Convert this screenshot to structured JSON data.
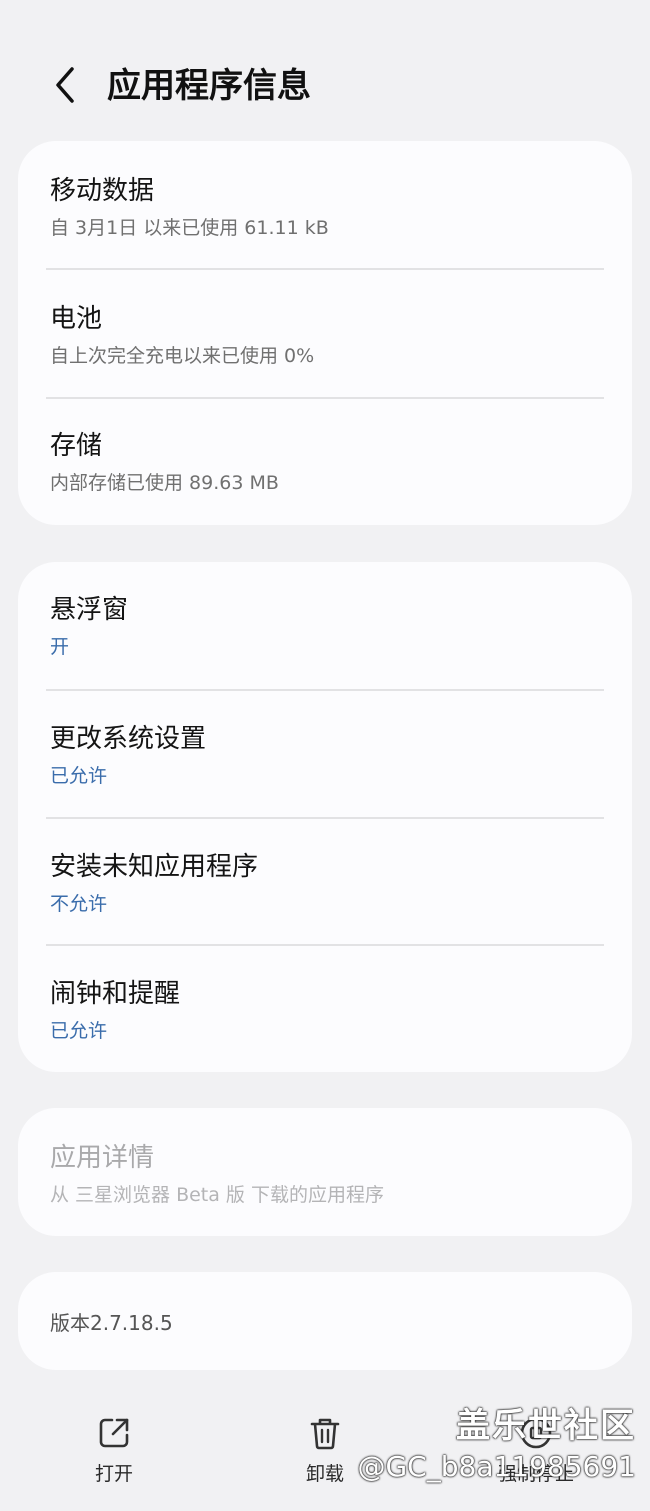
{
  "header": {
    "title": "应用程序信息"
  },
  "usage": {
    "items": [
      {
        "title": "移动数据",
        "subtitle": "自 3月1日 以来已使用 61.11 kB"
      },
      {
        "title": "电池",
        "subtitle": "自上次完全充电以来已使用 0%"
      },
      {
        "title": "存储",
        "subtitle": "内部存储已使用 89.63 MB"
      }
    ]
  },
  "permissions": {
    "items": [
      {
        "title": "悬浮窗",
        "subtitle": "开"
      },
      {
        "title": "更改系统设置",
        "subtitle": "已允许"
      },
      {
        "title": "安装未知应用程序",
        "subtitle": "不允许"
      },
      {
        "title": "闹钟和提醒",
        "subtitle": "已允许"
      }
    ]
  },
  "details": {
    "title": "应用详情",
    "subtitle": "从 三星浏览器 Beta 版 下载的应用程序"
  },
  "version": {
    "text": "版本2.7.18.5"
  },
  "actions": {
    "open": "打开",
    "uninstall": "卸载",
    "force_stop": "强制停止"
  },
  "watermark": {
    "line1": "盖乐世社区",
    "line2": "@GC_b8a11985691"
  },
  "colors": {
    "background": "#f1f1f3",
    "card": "#fcfcfe",
    "accent": "#3a6cab"
  },
  "icons": {
    "back": "chevron-left-icon",
    "open": "open-external-icon",
    "uninstall": "trash-icon",
    "force_stop": "stop-icon"
  }
}
